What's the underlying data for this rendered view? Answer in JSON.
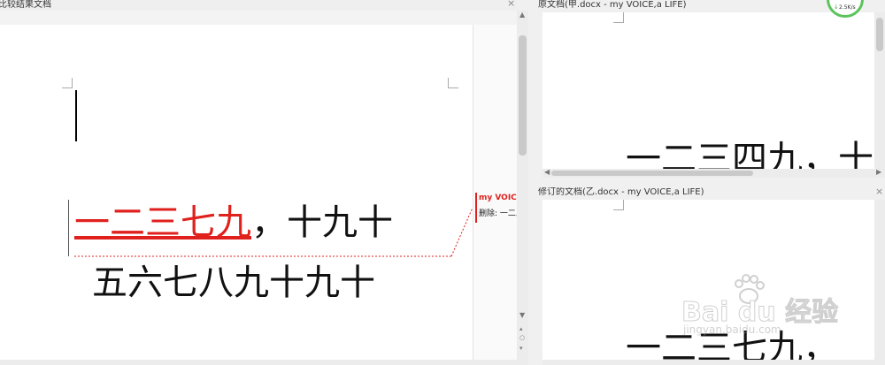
{
  "left_pane": {
    "title": "比较结果文档",
    "line1_deleted": "一二三七九",
    "line1_rest": "，十九十",
    "line2": "五六七八九十九十",
    "comment_author": "my VOICE,",
    "comment_text": "删除: 一二三"
  },
  "right_top": {
    "title": "原文档(甲.docx - my VOICE,a LIFE)",
    "body_text": "一二三四九，十"
  },
  "right_bottom": {
    "title": "修订的文档(乙.docx - my VOICE,a LIFE)",
    "body_text": "一二三七九，"
  },
  "badge": {
    "speed": "2.5K/s"
  },
  "watermark": {
    "brand": "Bai du 经验",
    "url": "jingyan.baidu.com"
  },
  "colors": {
    "deleted": "#e0201c",
    "revision_line": "#e0201c",
    "badge_ring": "#5bc45b"
  }
}
